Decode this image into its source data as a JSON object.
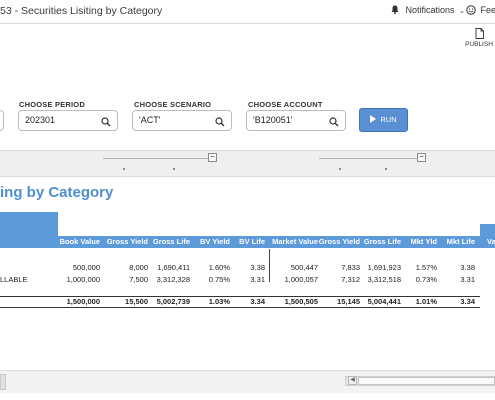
{
  "titlebar": {
    "app_title": "53 - Securities Lisiting by Category",
    "notifications_label": "Notifications",
    "feedback_label": "Feed"
  },
  "toolbar": {
    "publish_label": "PUBLISH"
  },
  "params": {
    "period_label": "CHOOSE PERIOD",
    "period_value": "202301",
    "scenario_label": "CHOOSE SCENARIO",
    "scenario_value": "'ACT'",
    "account_label": "CHOOSE ACCOUNT",
    "account_value": "'B120051'",
    "run_label": "RUN"
  },
  "report": {
    "title": "ing by Category",
    "columns": [
      "Book Value",
      "Gross Yield",
      "Gross Life",
      "BV Yield",
      "BV Life",
      "Market Value",
      "Gross Yield",
      "Gross Life",
      "Mkt Yld",
      "Mkt Life",
      "Va"
    ],
    "rows": [
      {
        "label": "",
        "values": [
          "500,000",
          "8,000",
          "1,690,411",
          "1.60%",
          "3.38",
          "500,447",
          "7,833",
          "1,691,923",
          "1.57%",
          "3.38"
        ]
      },
      {
        "label": "LLABLE",
        "values": [
          "1,000,000",
          "7,500",
          "3,312,328",
          "0.75%",
          "3.31",
          "1,000,057",
          "7,312",
          "3,312,518",
          "0.73%",
          "3.31"
        ]
      }
    ],
    "totals": [
      "1,500,000",
      "15,500",
      "5,002,739",
      "1.03%",
      "3.34",
      "1,500,505",
      "15,145",
      "5,004,441",
      "1.01%",
      "3.34"
    ]
  },
  "icons": {
    "notifications": "bell-icon",
    "feedback": "smiley-icon",
    "publish": "document-icon",
    "search": "search-icon",
    "run": "play-icon"
  },
  "colors": {
    "accent": "#4f8fd1",
    "header_bg": "#5d9ad9",
    "run_button": "#5b8fd3"
  }
}
